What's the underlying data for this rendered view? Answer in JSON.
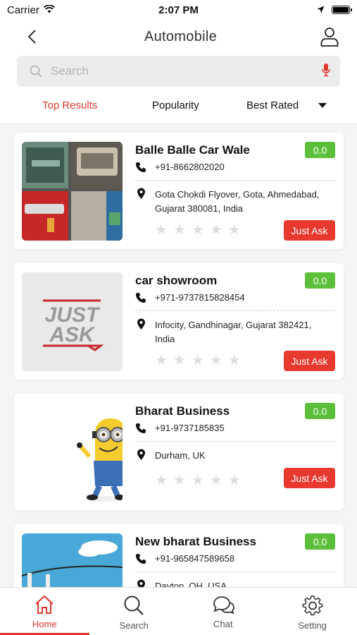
{
  "status": {
    "carrier": "Carrier",
    "time": "2:07 PM"
  },
  "nav": {
    "title": "Automobile"
  },
  "search": {
    "placeholder": "Search"
  },
  "filters": {
    "tabs": [
      "Top Results",
      "Popularity",
      "Best Rated"
    ],
    "active": "Top Results"
  },
  "listings": [
    {
      "name": "Balle Balle Car Wale",
      "rating": "0.0",
      "phone": "+91-8662802020",
      "address": "Gota Chokdi Flyover, Gota, Ahmedabad, Gujarat 380081, India",
      "stars": 0,
      "cta": "Just Ask"
    },
    {
      "name": "car showroom",
      "rating": "0.0",
      "phone": "+971-9737815828454",
      "address": "Infocity, Gandhinagar, Gujarat 382421, India",
      "stars": 0,
      "cta": "Just Ask",
      "logo_line1": "JUST",
      "logo_line2": "ASK"
    },
    {
      "name": "Bharat Business",
      "rating": "0.0",
      "phone": "+91-9737185835",
      "address": "Durham, UK",
      "stars": 0,
      "cta": "Just Ask"
    },
    {
      "name": "New bharat Business",
      "rating": "0.0",
      "phone": "+91-965847589658",
      "address": "Dayton, OH, USA"
    }
  ],
  "tab_bar": {
    "items": [
      "Home",
      "Search",
      "Chat",
      "Setting"
    ],
    "active": "Home"
  },
  "colors": {
    "accent": "#e0362c",
    "rating": "#5bbf3a",
    "cta": "#e8392f"
  },
  "icons": {
    "back": "chevron-left-icon",
    "profile": "user-icon",
    "search": "search-icon",
    "mic": "microphone-icon",
    "phone": "phone-icon",
    "location": "map-pin-icon",
    "home": "home-icon",
    "chat": "chat-icon",
    "setting": "gear-icon"
  }
}
